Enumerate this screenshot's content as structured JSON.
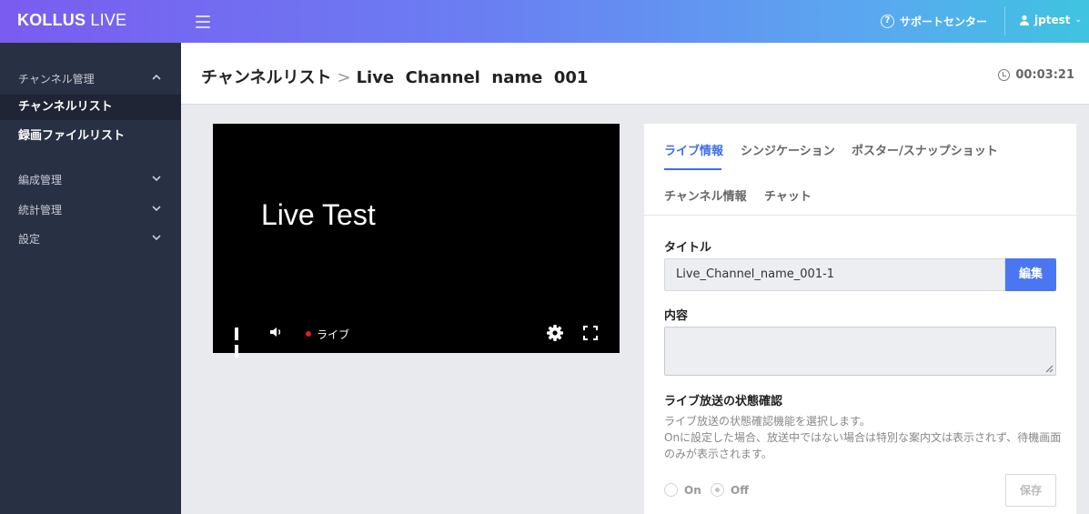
{
  "header": {
    "logo_bold": "KOLLUS",
    "logo_light": " LIVE",
    "support_label": "サポートセンター",
    "username": "jptest"
  },
  "sidebar": {
    "channel_group": "チャンネル管理",
    "items": [
      {
        "label": "チャンネルリスト"
      },
      {
        "label": "録画ファイルリスト"
      }
    ],
    "groups": [
      {
        "label": "編成管理"
      },
      {
        "label": "統計管理"
      },
      {
        "label": "設定"
      }
    ]
  },
  "page": {
    "breadcrumb_parent": "チャンネルリスト",
    "breadcrumb_sep": ">",
    "breadcrumb_current": "Live  Channel  name  001",
    "elapsed_time": "00:03:21"
  },
  "player": {
    "video_text": "Live Test",
    "live_label": "ライブ",
    "live_dot_color": "#e31b23"
  },
  "panel": {
    "tabs": [
      {
        "label": "ライブ情報"
      },
      {
        "label": "シンジケーション"
      },
      {
        "label": "ポスター/スナップショット"
      },
      {
        "label": "チャンネル情報"
      },
      {
        "label": "チャット"
      }
    ],
    "title_label": "タイトル",
    "title_value": "Live_Channel_name_001-1",
    "edit_label": "編集",
    "content_label": "内容",
    "status_label": "ライブ放送の状態確認",
    "status_desc_1": "ライブ放送の状態確認機能を選択します。",
    "status_desc_2": "Onに設定した場合、放送中ではない場合は特別な案内文は表示されず、待機画面のみが表示されます。",
    "radio_on": "On",
    "radio_off": "Off",
    "save_label": "保存",
    "accent_color": "#3e6ee8"
  }
}
